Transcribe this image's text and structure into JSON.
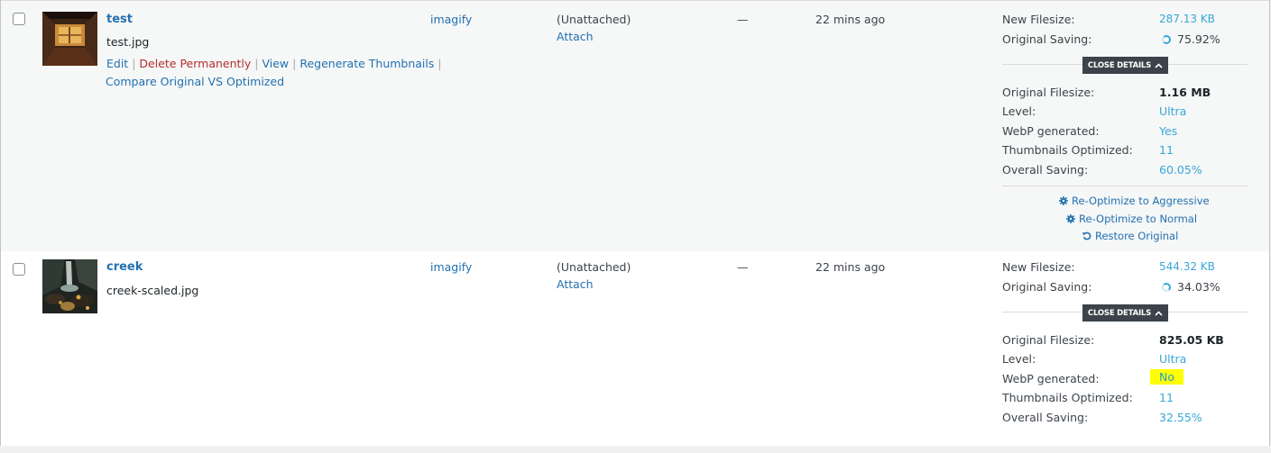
{
  "colors": {
    "link": "#2271b1",
    "delete": "#b32d2e",
    "value_blue": "#38a7d8",
    "close_btn_bg": "#3c434a",
    "highlight": "#ffff00"
  },
  "rows": [
    {
      "title": "test",
      "filename": "test.jpg",
      "actions": {
        "edit": "Edit",
        "delete": "Delete Permanently",
        "view": "View",
        "regenerate": "Regenerate Thumbnails",
        "compare": "Compare Original VS Optimized",
        "sep": "|"
      },
      "author": "imagify",
      "attached": "(Unattached)",
      "attach_link": "Attach",
      "comments": "—",
      "date": "22 mins ago",
      "imagify": {
        "new_filesize_label": "New Filesize:",
        "new_filesize": "287.13 KB",
        "original_saving_label": "Original Saving:",
        "original_saving": "75.92%",
        "close_details": "CLOSE DETAILS",
        "original_filesize_label": "Original Filesize:",
        "original_filesize": "1.16 MB",
        "level_label": "Level:",
        "level": "Ultra",
        "webp_label": "WebP generated:",
        "webp": "Yes",
        "thumbs_label": "Thumbnails Optimized:",
        "thumbs": "11",
        "overall_label": "Overall Saving:",
        "overall": "60.05%",
        "reoptimize_aggressive": "Re-Optimize to Aggressive",
        "reoptimize_normal": "Re-Optimize to Normal",
        "restore": "Restore Original"
      }
    },
    {
      "title": "creek",
      "filename": "creek-scaled.jpg",
      "author": "imagify",
      "attached": "(Unattached)",
      "attach_link": "Attach",
      "comments": "—",
      "date": "22 mins ago",
      "imagify": {
        "new_filesize_label": "New Filesize:",
        "new_filesize": "544.32 KB",
        "original_saving_label": "Original Saving:",
        "original_saving": "34.03%",
        "close_details": "CLOSE DETAILS",
        "original_filesize_label": "Original Filesize:",
        "original_filesize": "825.05 KB",
        "level_label": "Level:",
        "level": "Ultra",
        "webp_label": "WebP generated:",
        "webp": "No",
        "thumbs_label": "Thumbnails Optimized:",
        "thumbs": "11",
        "overall_label": "Overall Saving:",
        "overall": "32.55%"
      }
    }
  ]
}
